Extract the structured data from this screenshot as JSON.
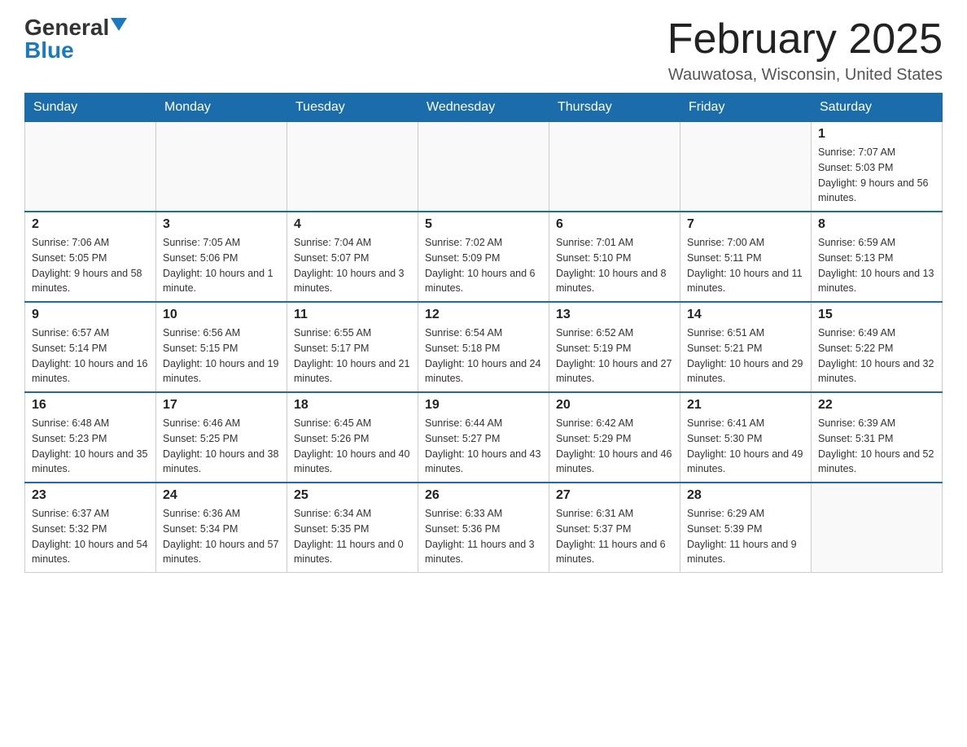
{
  "header": {
    "logo_general": "General",
    "logo_blue": "Blue",
    "title": "February 2025",
    "subtitle": "Wauwatosa, Wisconsin, United States"
  },
  "weekdays": [
    "Sunday",
    "Monday",
    "Tuesday",
    "Wednesday",
    "Thursday",
    "Friday",
    "Saturday"
  ],
  "weeks": [
    [
      {
        "day": "",
        "info": ""
      },
      {
        "day": "",
        "info": ""
      },
      {
        "day": "",
        "info": ""
      },
      {
        "day": "",
        "info": ""
      },
      {
        "day": "",
        "info": ""
      },
      {
        "day": "",
        "info": ""
      },
      {
        "day": "1",
        "info": "Sunrise: 7:07 AM\nSunset: 5:03 PM\nDaylight: 9 hours and 56 minutes."
      }
    ],
    [
      {
        "day": "2",
        "info": "Sunrise: 7:06 AM\nSunset: 5:05 PM\nDaylight: 9 hours and 58 minutes."
      },
      {
        "day": "3",
        "info": "Sunrise: 7:05 AM\nSunset: 5:06 PM\nDaylight: 10 hours and 1 minute."
      },
      {
        "day": "4",
        "info": "Sunrise: 7:04 AM\nSunset: 5:07 PM\nDaylight: 10 hours and 3 minutes."
      },
      {
        "day": "5",
        "info": "Sunrise: 7:02 AM\nSunset: 5:09 PM\nDaylight: 10 hours and 6 minutes."
      },
      {
        "day": "6",
        "info": "Sunrise: 7:01 AM\nSunset: 5:10 PM\nDaylight: 10 hours and 8 minutes."
      },
      {
        "day": "7",
        "info": "Sunrise: 7:00 AM\nSunset: 5:11 PM\nDaylight: 10 hours and 11 minutes."
      },
      {
        "day": "8",
        "info": "Sunrise: 6:59 AM\nSunset: 5:13 PM\nDaylight: 10 hours and 13 minutes."
      }
    ],
    [
      {
        "day": "9",
        "info": "Sunrise: 6:57 AM\nSunset: 5:14 PM\nDaylight: 10 hours and 16 minutes."
      },
      {
        "day": "10",
        "info": "Sunrise: 6:56 AM\nSunset: 5:15 PM\nDaylight: 10 hours and 19 minutes."
      },
      {
        "day": "11",
        "info": "Sunrise: 6:55 AM\nSunset: 5:17 PM\nDaylight: 10 hours and 21 minutes."
      },
      {
        "day": "12",
        "info": "Sunrise: 6:54 AM\nSunset: 5:18 PM\nDaylight: 10 hours and 24 minutes."
      },
      {
        "day": "13",
        "info": "Sunrise: 6:52 AM\nSunset: 5:19 PM\nDaylight: 10 hours and 27 minutes."
      },
      {
        "day": "14",
        "info": "Sunrise: 6:51 AM\nSunset: 5:21 PM\nDaylight: 10 hours and 29 minutes."
      },
      {
        "day": "15",
        "info": "Sunrise: 6:49 AM\nSunset: 5:22 PM\nDaylight: 10 hours and 32 minutes."
      }
    ],
    [
      {
        "day": "16",
        "info": "Sunrise: 6:48 AM\nSunset: 5:23 PM\nDaylight: 10 hours and 35 minutes."
      },
      {
        "day": "17",
        "info": "Sunrise: 6:46 AM\nSunset: 5:25 PM\nDaylight: 10 hours and 38 minutes."
      },
      {
        "day": "18",
        "info": "Sunrise: 6:45 AM\nSunset: 5:26 PM\nDaylight: 10 hours and 40 minutes."
      },
      {
        "day": "19",
        "info": "Sunrise: 6:44 AM\nSunset: 5:27 PM\nDaylight: 10 hours and 43 minutes."
      },
      {
        "day": "20",
        "info": "Sunrise: 6:42 AM\nSunset: 5:29 PM\nDaylight: 10 hours and 46 minutes."
      },
      {
        "day": "21",
        "info": "Sunrise: 6:41 AM\nSunset: 5:30 PM\nDaylight: 10 hours and 49 minutes."
      },
      {
        "day": "22",
        "info": "Sunrise: 6:39 AM\nSunset: 5:31 PM\nDaylight: 10 hours and 52 minutes."
      }
    ],
    [
      {
        "day": "23",
        "info": "Sunrise: 6:37 AM\nSunset: 5:32 PM\nDaylight: 10 hours and 54 minutes."
      },
      {
        "day": "24",
        "info": "Sunrise: 6:36 AM\nSunset: 5:34 PM\nDaylight: 10 hours and 57 minutes."
      },
      {
        "day": "25",
        "info": "Sunrise: 6:34 AM\nSunset: 5:35 PM\nDaylight: 11 hours and 0 minutes."
      },
      {
        "day": "26",
        "info": "Sunrise: 6:33 AM\nSunset: 5:36 PM\nDaylight: 11 hours and 3 minutes."
      },
      {
        "day": "27",
        "info": "Sunrise: 6:31 AM\nSunset: 5:37 PM\nDaylight: 11 hours and 6 minutes."
      },
      {
        "day": "28",
        "info": "Sunrise: 6:29 AM\nSunset: 5:39 PM\nDaylight: 11 hours and 9 minutes."
      },
      {
        "day": "",
        "info": ""
      }
    ]
  ]
}
